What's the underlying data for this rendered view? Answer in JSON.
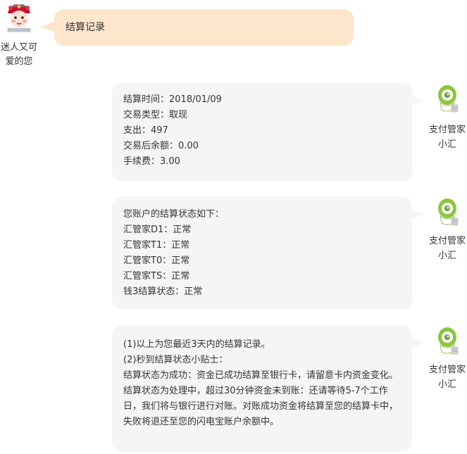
{
  "user": {
    "name_line1": "迷人又可",
    "name_line2": "爱的您",
    "message": "结算记录"
  },
  "bot": {
    "name_line1": "支付管家",
    "name_line2": "小汇"
  },
  "messages": [
    {
      "lines": [
        "结算时间：2018/01/09",
        "交易类型：取现",
        "支出：497",
        "交易后余额：0.00",
        "手续费：3.00"
      ]
    },
    {
      "lines": [
        "您账户的结算状态如下：",
        "汇管家D1：正常",
        "汇管家T1：正常",
        "汇管家T0：正常",
        "汇管家TS：正常",
        "钱3结算状态：正常"
      ]
    },
    {
      "lines": [
        "(1)以上为您最近3天内的结算记录。",
        "(2)秒到结算状态小贴士：",
        "结算状态为成功：资金已成功结算至银行卡，请留意卡内资金变化。",
        "结算状态为处理中，超过30分钟资金未到账：还请等待5-7个工作日，我们将与银行进行对账。对账成功资金将结算至您的结算卡中，失败将退还至您的闪电宝账户余额中。"
      ]
    }
  ],
  "colors": {
    "user_bubble": "#fde6cc",
    "bot_bubble": "#f5f5f5",
    "bot_avatar_green": "#8cc63f"
  }
}
